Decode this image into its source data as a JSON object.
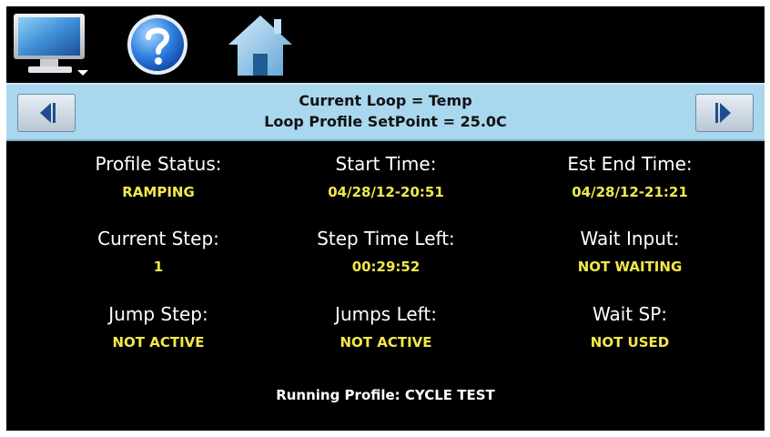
{
  "toolbar": {
    "icons": [
      "monitor-icon",
      "help-icon",
      "home-icon"
    ]
  },
  "loop": {
    "current_loop": "Current Loop = Temp",
    "setpoint": "Loop Profile SetPoint = 25.0C",
    "prev_icon": "prev-loop-icon",
    "next_icon": "next-loop-icon"
  },
  "status": {
    "profile_status_label": "Profile Status:",
    "profile_status_value": "RAMPING",
    "start_time_label": "Start Time:",
    "start_time_value": "04/28/12-20:51",
    "est_end_time_label": "Est End Time:",
    "est_end_time_value": "04/28/12-21:21",
    "current_step_label": "Current Step:",
    "current_step_value": "1",
    "step_time_left_label": "Step Time Left:",
    "step_time_left_value": "00:29:52",
    "wait_input_label": "Wait Input:",
    "wait_input_value": "NOT WAITING",
    "jump_step_label": "Jump Step:",
    "jump_step_value": "NOT ACTIVE",
    "jumps_left_label": "Jumps Left:",
    "jumps_left_value": "NOT ACTIVE",
    "wait_sp_label": "Wait SP:",
    "wait_sp_value": "NOT USED"
  },
  "footer": {
    "running_profile": "Running Profile: CYCLE TEST"
  },
  "colors": {
    "background": "#000000",
    "bar": "#a9d7ee",
    "label": "#ffffff",
    "value": "#f2e84a"
  }
}
